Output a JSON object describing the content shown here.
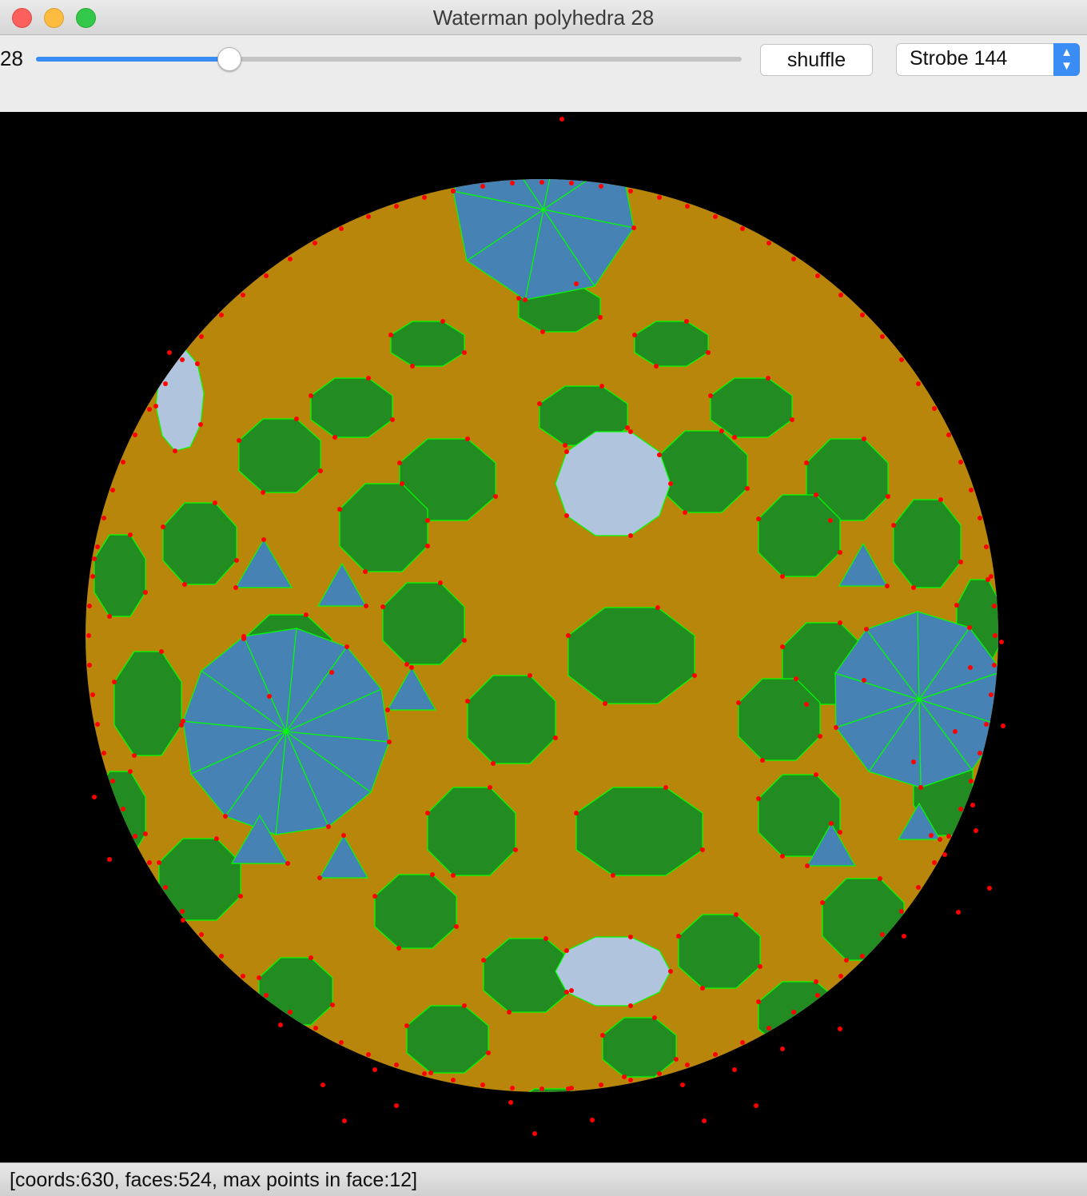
{
  "window": {
    "title": "Waterman polyhedra 28"
  },
  "toolbar": {
    "level_label": "28",
    "slider": {
      "value": 28,
      "min": 0,
      "max": 100,
      "fraction": 0.274
    },
    "shuffle_label": "shuffle",
    "selected_palette": "Strobe 144"
  },
  "status": {
    "text": "[coords:630, faces:524, max points in face:12]"
  },
  "colors": {
    "green": "#228b22",
    "gold": "#b8860b",
    "steel": "#4682b4",
    "light": "#b0c4de",
    "edge": "#00ff00",
    "vertex": "#ff0000"
  },
  "icons": {
    "select_arrows": "chevron-up-down-icon"
  }
}
